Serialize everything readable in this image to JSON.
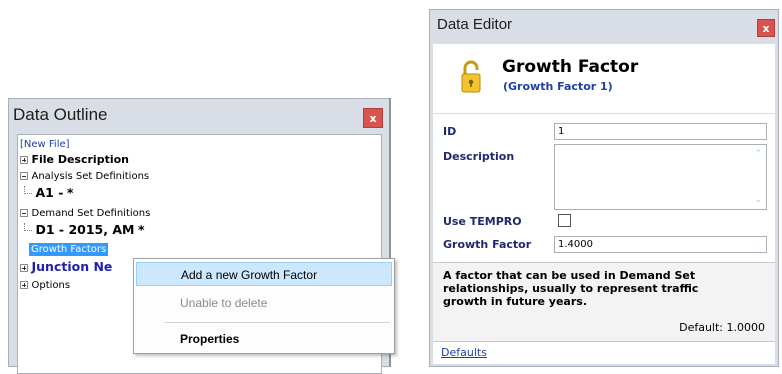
{
  "outline": {
    "title": "Data Outline",
    "close": "x",
    "tree": {
      "new_file": "[New File]",
      "file_description": "File Description",
      "analysis_set_definitions": "Analysis Set Definitions",
      "analysis_set_a1": "A1 -",
      "analysis_set_a1_star": "*",
      "demand_set_definitions": "Demand Set Definitions",
      "demand_set_d1": "D1 - 2015, AM",
      "demand_set_d1_star": "*",
      "growth_factors": "Growth Factors",
      "junction_network": "Junction Ne",
      "options": "Options"
    }
  },
  "context_menu": {
    "items": [
      {
        "label": "Add a new Growth Factor"
      },
      {
        "label": "Unable to delete"
      },
      {
        "label": "Properties"
      }
    ]
  },
  "editor": {
    "title": "Data Editor",
    "close": "x",
    "header_title": "Growth Factor",
    "header_subtitle": "(Growth Factor 1)",
    "fields": {
      "id_label": "ID",
      "id_value": "1",
      "description_label": "Description",
      "description_value": "",
      "use_tempro_label": "Use TEMPRO",
      "growth_factor_label": "Growth Factor",
      "growth_factor_value": "1.4000"
    },
    "help_text": "A factor that can be used in Demand Set relationships, usually to represent traffic growth in future years.",
    "help_default": "Default: 1.0000",
    "defaults_link": "Defaults"
  },
  "colors": {
    "panel_bg": "#d8dde6",
    "close_red": "#d9534f",
    "selection_blue": "#3399ff",
    "menu_highlight": "#cce8ff",
    "link_blue": "#1f3fa8"
  }
}
